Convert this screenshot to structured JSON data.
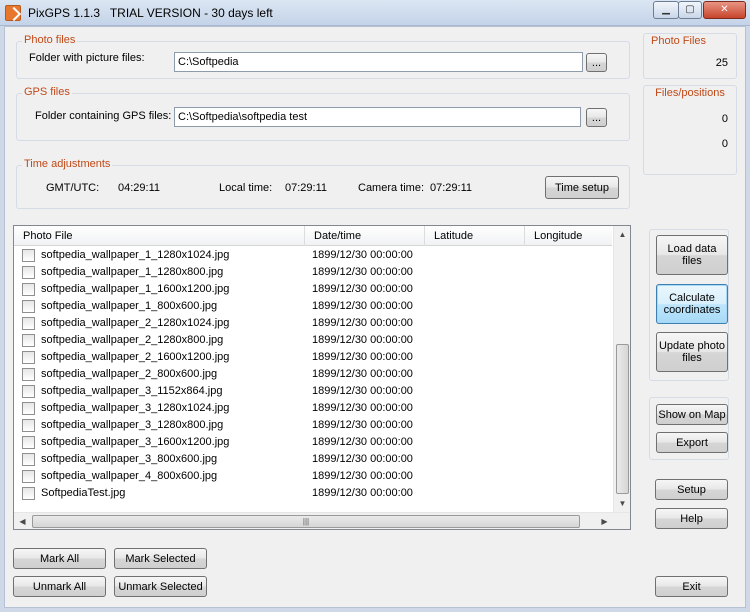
{
  "window": {
    "title": "PixGPS 1.1.3   TRIAL VERSION - 30 days left",
    "minimize_glyph": "▁",
    "maximize_glyph": "▢",
    "close_glyph": "✕"
  },
  "photo_files": {
    "group_title": "Photo files",
    "folder_label": "Folder with picture files:",
    "folder_value": "C:\\Softpedia",
    "browse_label": "..."
  },
  "gps_files": {
    "group_title": "GPS files",
    "folder_label": "Folder containing GPS files:",
    "folder_value": "C:\\Softpedia\\softpedia test",
    "browse_label": "..."
  },
  "time_adjustments": {
    "group_title": "Time adjustments",
    "gmt_label": "GMT/UTC:",
    "gmt_value": "04:29:11",
    "local_label": "Local time:",
    "local_value": "07:29:11",
    "camera_label": "Camera time:",
    "camera_value": "07:29:11",
    "setup_button": "Time setup"
  },
  "stats": {
    "photo_files_title": "Photo Files",
    "photo_files_count": "25",
    "files_positions_title": "Files/positions",
    "files_value": "0",
    "positions_value": "0"
  },
  "list": {
    "columns": [
      "Photo File",
      "Date/time",
      "Latitude",
      "Longitude"
    ],
    "rows": [
      {
        "file": "softpedia_wallpaper_1_1280x1024.jpg",
        "datetime": "1899/12/30 00:00:00",
        "lat": "",
        "lon": ""
      },
      {
        "file": "softpedia_wallpaper_1_1280x800.jpg",
        "datetime": "1899/12/30 00:00:00",
        "lat": "",
        "lon": ""
      },
      {
        "file": "softpedia_wallpaper_1_1600x1200.jpg",
        "datetime": "1899/12/30 00:00:00",
        "lat": "",
        "lon": ""
      },
      {
        "file": "softpedia_wallpaper_1_800x600.jpg",
        "datetime": "1899/12/30 00:00:00",
        "lat": "",
        "lon": ""
      },
      {
        "file": "softpedia_wallpaper_2_1280x1024.jpg",
        "datetime": "1899/12/30 00:00:00",
        "lat": "",
        "lon": ""
      },
      {
        "file": "softpedia_wallpaper_2_1280x800.jpg",
        "datetime": "1899/12/30 00:00:00",
        "lat": "",
        "lon": ""
      },
      {
        "file": "softpedia_wallpaper_2_1600x1200.jpg",
        "datetime": "1899/12/30 00:00:00",
        "lat": "",
        "lon": ""
      },
      {
        "file": "softpedia_wallpaper_2_800x600.jpg",
        "datetime": "1899/12/30 00:00:00",
        "lat": "",
        "lon": ""
      },
      {
        "file": "softpedia_wallpaper_3_1152x864.jpg",
        "datetime": "1899/12/30 00:00:00",
        "lat": "",
        "lon": ""
      },
      {
        "file": "softpedia_wallpaper_3_1280x1024.jpg",
        "datetime": "1899/12/30 00:00:00",
        "lat": "",
        "lon": ""
      },
      {
        "file": "softpedia_wallpaper_3_1280x800.jpg",
        "datetime": "1899/12/30 00:00:00",
        "lat": "",
        "lon": ""
      },
      {
        "file": "softpedia_wallpaper_3_1600x1200.jpg",
        "datetime": "1899/12/30 00:00:00",
        "lat": "",
        "lon": ""
      },
      {
        "file": "softpedia_wallpaper_3_800x600.jpg",
        "datetime": "1899/12/30 00:00:00",
        "lat": "",
        "lon": ""
      },
      {
        "file": "softpedia_wallpaper_4_800x600.jpg",
        "datetime": "1899/12/30 00:00:00",
        "lat": "",
        "lon": ""
      },
      {
        "file": "SoftpediaTest.jpg",
        "datetime": "1899/12/30 00:00:00",
        "lat": "",
        "lon": ""
      }
    ]
  },
  "actions": {
    "load_data_files": "Load data files",
    "calculate_coordinates": "Calculate coordinates",
    "update_photo_files": "Update  photo files",
    "show_on_map": "Show on Map",
    "export": "Export",
    "setup": "Setup",
    "help": "Help",
    "exit": "Exit",
    "mark_all": "Mark All",
    "mark_selected": "Mark Selected",
    "unmark_all": "Unmark All",
    "unmark_selected": "Unmark Selected"
  },
  "colors": {
    "group_title": "#c04a18",
    "window_frame": "#cfd8e6",
    "client_bg": "#f0f0f0"
  },
  "icons": {
    "app_icon": "pixgps-app-icon",
    "scroll_up": "▲",
    "scroll_down": "▼",
    "scroll_left": "◀",
    "scroll_right": "▶",
    "thumb_grip": "|||"
  }
}
